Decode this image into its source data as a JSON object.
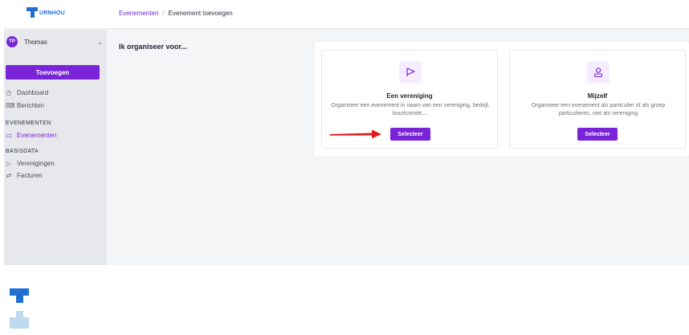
{
  "header": {
    "logo_text": "URNHOU",
    "breadcrumb": {
      "link": "Evenementen",
      "separator": "/",
      "current": "Evenement toevoegen"
    }
  },
  "sidebar": {
    "user": {
      "initials": "TP",
      "name": "Thomas"
    },
    "add_button": "Toevoegen",
    "items_top": [
      {
        "label": "Dashboard",
        "icon": "dashboard-icon"
      },
      {
        "label": "Berichten",
        "icon": "messages-icon"
      }
    ],
    "section_events": "EVENEMENTEN",
    "events_item": {
      "label": "Evenementen",
      "icon": "ticket-icon",
      "active": true
    },
    "section_basisdata": "BASISDATA",
    "items_basisdata": [
      {
        "label": "Verenigingen",
        "icon": "flag-icon"
      },
      {
        "label": "Facturen",
        "icon": "transfer-icon"
      }
    ]
  },
  "main": {
    "title": "Ik organiseer voor...",
    "cards": [
      {
        "icon": "flag-icon",
        "title": "Een vereniging",
        "description": "Organiseer een evenement in naam van een vereniging, bedrijf, buurtcomité,...",
        "button": "Selecteer"
      },
      {
        "icon": "user-icon",
        "title": "Mijzelf",
        "description": "Organiseer een evenement als particulier of als groep particulieren, niet als vereniging",
        "button": "Selecteer"
      }
    ]
  },
  "colors": {
    "accent": "#7a24d9",
    "brand_blue": "#1f6fd1",
    "arrow_red": "#e31b1b",
    "sidebar_bg": "#e7e8ec",
    "content_bg": "#f4f5f7"
  }
}
